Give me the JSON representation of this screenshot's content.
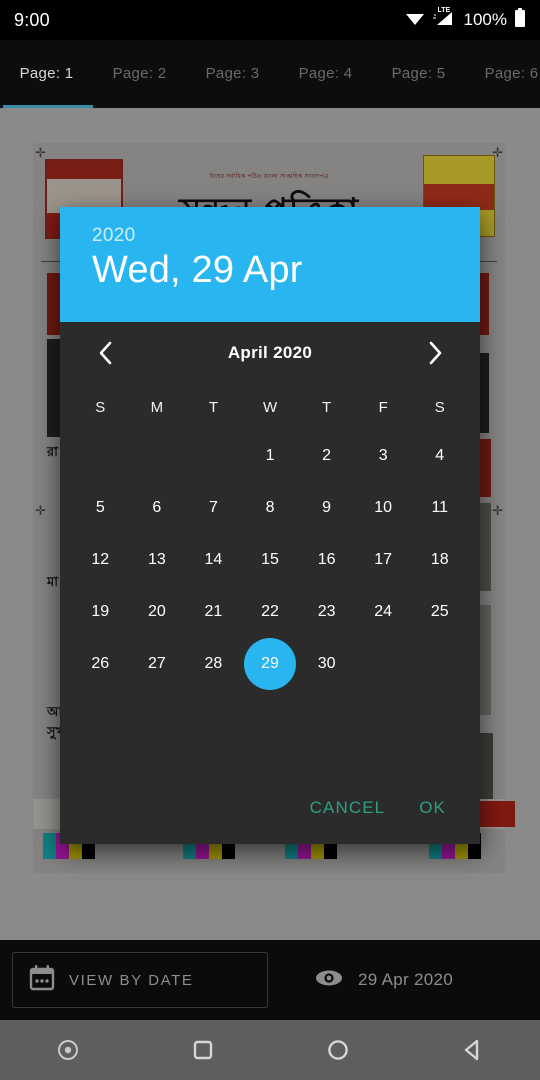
{
  "statusbar": {
    "clock": "9:00",
    "battery_pct": "100%",
    "icons": [
      "wifi-icon",
      "lte-signal-icon",
      "battery-icon"
    ],
    "network_label": "LTE"
  },
  "tabbar": {
    "tabs": [
      {
        "label": "Page: 1",
        "active": true
      },
      {
        "label": "Page: 2",
        "active": false
      },
      {
        "label": "Page: 3",
        "active": false
      },
      {
        "label": "Page: 4",
        "active": false
      },
      {
        "label": "Page: 5",
        "active": false
      },
      {
        "label": "Page: 6",
        "active": false
      }
    ],
    "indicator_color": "#3c8ea8"
  },
  "backdrop": {
    "masthead_kicker": "বিশ্বের সর্বাধিক পঠিত বাংলা সাপ্তাহিক সংবাদপত্র",
    "masthead_title": "সন্দন পত্রিকা",
    "section_headings": [
      "রা",
      "মা",
      "আ",
      "সুখ"
    ],
    "registration_colors": [
      "#17b3b8",
      "#d41fd4",
      "#e2d200",
      "#000000"
    ]
  },
  "dialog": {
    "header": {
      "year": "2020",
      "date_line": "Wed, 29 Apr",
      "background_color": "#29b6f0"
    },
    "month_nav": {
      "prev_icon": "chevron-left-icon",
      "month_label": "April 2020",
      "next_icon": "chevron-right-icon"
    },
    "weekdays": [
      "S",
      "M",
      "T",
      "W",
      "T",
      "F",
      "S"
    ],
    "weeks": [
      [
        "",
        "",
        "",
        "1",
        "2",
        "3",
        "4"
      ],
      [
        "5",
        "6",
        "7",
        "8",
        "9",
        "10",
        "11"
      ],
      [
        "12",
        "13",
        "14",
        "15",
        "16",
        "17",
        "18"
      ],
      [
        "19",
        "20",
        "21",
        "22",
        "23",
        "24",
        "25"
      ],
      [
        "26",
        "27",
        "28",
        "29",
        "30",
        "",
        ""
      ]
    ],
    "selected_day": "29",
    "selection_color": "#29b6f0",
    "actions": {
      "cancel_label": "CANCEL",
      "ok_label": "OK",
      "action_color": "#2e9e83"
    }
  },
  "bottombar": {
    "view_by_date": {
      "icon": "calendar-icon",
      "label": "VIEW BY DATE"
    },
    "current_view": {
      "icon": "eye-icon",
      "label": "29 Apr 2020"
    }
  },
  "navbar": {
    "keys": [
      {
        "name": "screen-record-icon"
      },
      {
        "name": "recents-icon"
      },
      {
        "name": "home-icon"
      },
      {
        "name": "back-icon"
      }
    ]
  }
}
